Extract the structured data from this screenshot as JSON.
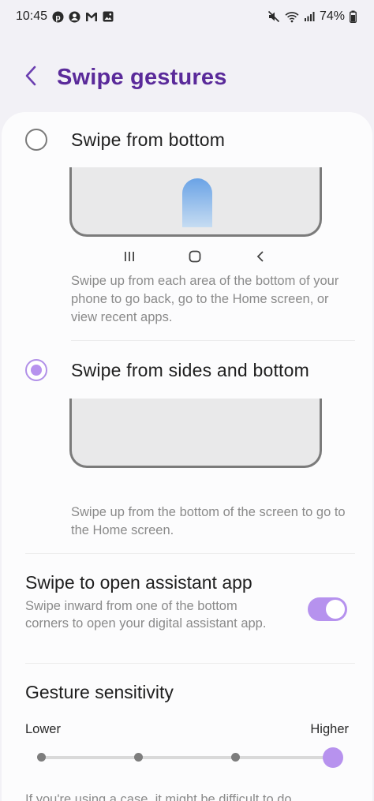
{
  "status_bar": {
    "time": "10:45",
    "battery": "74%",
    "left_icons": [
      "pinterest-icon",
      "account-circle-icon",
      "gmail-icon",
      "gallery-icon"
    ],
    "right_icons": [
      "mute-icon",
      "wifi-icon",
      "signal-icon"
    ]
  },
  "header": {
    "back_icon": "chevron-left-icon",
    "title": "Swipe gestures"
  },
  "options": [
    {
      "label": "Swipe from bottom",
      "selected": false,
      "description": "Swipe up from each area of the bottom of your phone to go back, go to the Home screen, or view recent apps."
    },
    {
      "label": "Swipe from sides and bottom",
      "selected": true,
      "description": "Swipe up from the bottom of the screen to go to the Home screen."
    }
  ],
  "nav_keys": [
    "recents-key-icon",
    "home-key-icon",
    "back-key-icon"
  ],
  "assistant": {
    "title": "Swipe to open assistant app",
    "description": "Swipe inward from one of the bottom corners to open your digital assistant app.",
    "enabled": true
  },
  "sensitivity": {
    "title": "Gesture sensitivity",
    "low_label": "Lower",
    "high_label": "Higher",
    "steps": 4,
    "value": 4
  },
  "footnote": "If you're using a case, it might be difficult to do",
  "colors": {
    "accent": "#b792ee",
    "title": "#5a2a9a",
    "background": "#f2f1f6",
    "card": "#fcfcfd"
  }
}
